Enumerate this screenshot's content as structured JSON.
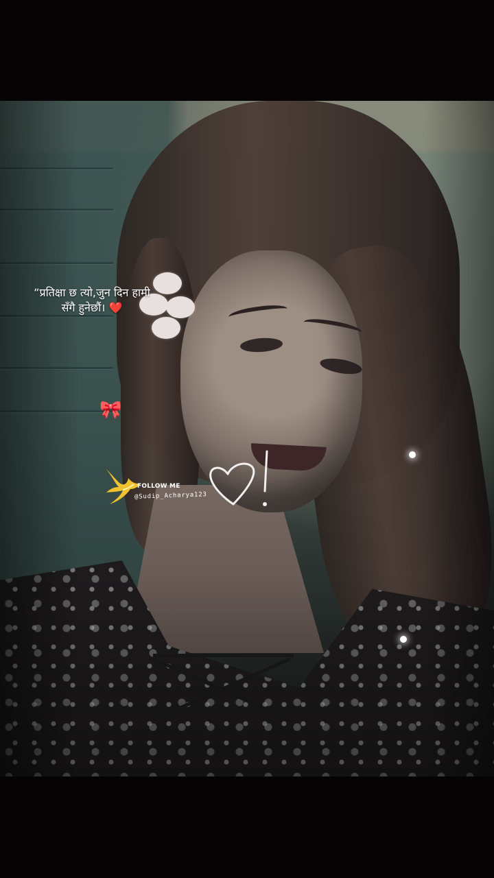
{
  "story": {
    "caption_line_1": "“प्रतिक्षा छ त्यो,जुन दिन हामी",
    "caption_line_2": "सँगै हुनेछौं।",
    "caption_emoji": "❤️",
    "bow_sticker": "🎀",
    "watermark": {
      "follow_text": "FOLLOW ME",
      "handle": "@Sudip_Acharya123",
      "icon": "golden-bird-icon"
    },
    "drawn_mark": "heart-exclamation-icon",
    "colors": {
      "background": "#060304",
      "caption": "#ffffff",
      "bird": "#f2c12e",
      "heart_emoji": "#e8222b"
    }
  }
}
